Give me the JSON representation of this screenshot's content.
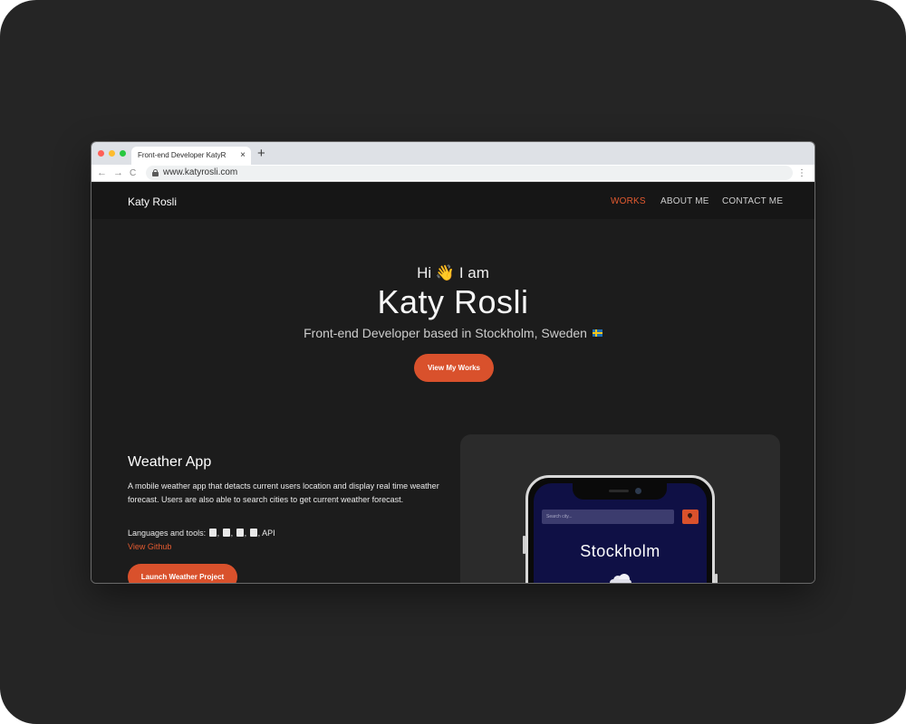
{
  "browser": {
    "tab_title": "Front-end Developer KatyR",
    "tab_close": "×",
    "new_tab": "+",
    "url": "www.katyrosli.com",
    "back": "←",
    "forward": "→",
    "reload": "C",
    "menu": "⋮"
  },
  "nav": {
    "brand": "Katy Rosli",
    "links": [
      {
        "label": "WORKS",
        "active": true
      },
      {
        "label": "ABOUT ME",
        "active": false
      },
      {
        "label": "CONTACT ME",
        "active": false
      }
    ]
  },
  "hero": {
    "greeting_hi": "Hi",
    "wave": "👋",
    "greeting_tail": "I am",
    "name": "Katy Rosli",
    "subtitle": "Front-end Developer based in Stockholm, Sweden",
    "cta": "View My Works"
  },
  "project": {
    "title": "Weather App",
    "description": "A mobile weather app that detacts current users location and display real time weather forecast. Users are also able to search cities to get current weather forecast.",
    "tools_label": "Languages and tools:",
    "tools_icons": [
      "html5-icon",
      "css3-icon",
      "javascript-icon",
      "bootstrap-icon"
    ],
    "tools_tail": ", API",
    "github_link": "View Github",
    "launch_button": "Launch Weather Project",
    "preview": {
      "search_placeholder": "Search city...",
      "city": "Stockholm"
    }
  },
  "colors": {
    "accent": "#d9512c",
    "page_bg": "#1c1c1c",
    "nav_bg": "#161616",
    "phone_screen": "#0f1045"
  }
}
